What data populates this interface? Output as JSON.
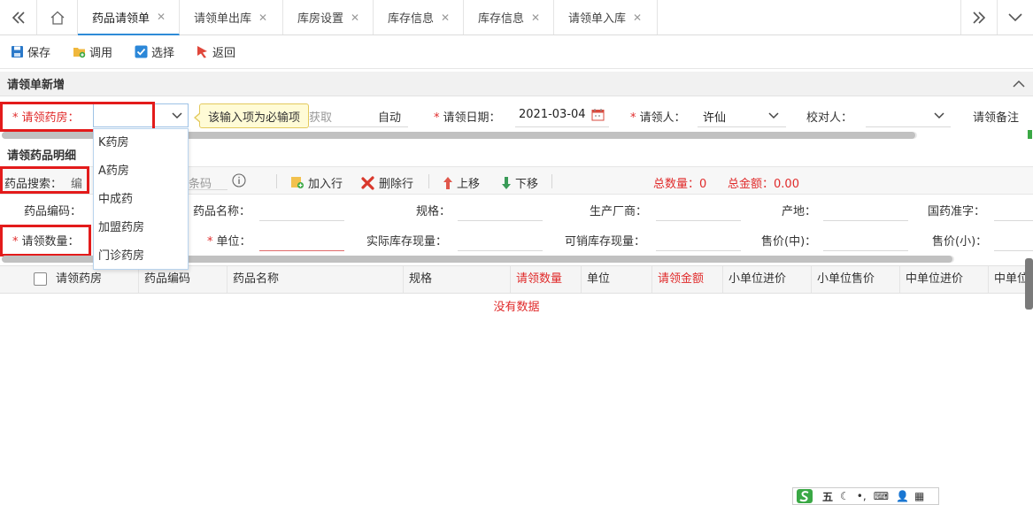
{
  "tabs": {
    "items": [
      {
        "label": "药品请领单"
      },
      {
        "label": "请领单出库"
      },
      {
        "label": "库房设置"
      },
      {
        "label": "库存信息"
      },
      {
        "label": "库存信息"
      },
      {
        "label": "请领单入库"
      }
    ],
    "close_glyph": "✕",
    "active_index": 0
  },
  "toolbar": {
    "save": "保存",
    "invoke": "调用",
    "select": "选择",
    "back": "返回"
  },
  "form_section": {
    "title": "请领单新增",
    "pharmacy_label": "请领药房：",
    "pharmacy_value": "",
    "acquire_partial": "获取",
    "auto_text": "自动",
    "date_label": "请领日期：",
    "date_value": "2021-03-04",
    "requester_label": "请领人：",
    "requester_value": "许仙",
    "checker_label": "校对人：",
    "checker_value": "",
    "remark_label": "请领备注",
    "required_mark": "*"
  },
  "tooltip": {
    "text": "该输入项为必输项"
  },
  "dropdown": {
    "options": [
      "K药房",
      "A药房",
      "中成药",
      "加盟药房",
      "门诊药房"
    ]
  },
  "detail_section": {
    "title": "请领药品明细",
    "search_label": "药品搜索：",
    "search_placeholder_a": "编",
    "search_placeholder_b": "条码",
    "add_row": "加入行",
    "delete_row": "删除行",
    "move_up": "上移",
    "move_down": "下移",
    "total_qty_label": "总数量：",
    "total_qty_value": "0",
    "total_amount_label": "总金额：",
    "total_amount_value": "0.00",
    "fields": {
      "drug_code": "药品编码：",
      "drug_name": "药品名称：",
      "spec": "规格：",
      "manufacturer": "生产厂商：",
      "origin": "产地：",
      "approval_no": "国药准字：",
      "qty": "请领数量：",
      "unit": "单位：",
      "actual_stock": "实际库存现量：",
      "sellable_stock": "可销库存现量：",
      "price_mid": "售价(中)：",
      "price_small": "售价(小)："
    }
  },
  "table": {
    "columns": [
      {
        "label": "请领药房",
        "red": false
      },
      {
        "label": "药品编码",
        "red": false
      },
      {
        "label": "药品名称",
        "red": false
      },
      {
        "label": "规格",
        "red": false
      },
      {
        "label": "请领数量",
        "red": true
      },
      {
        "label": "单位",
        "red": false
      },
      {
        "label": "请领金额",
        "red": true
      },
      {
        "label": "小单位进价",
        "red": false
      },
      {
        "label": "小单位售价",
        "red": false
      },
      {
        "label": "中单位进价",
        "red": false
      },
      {
        "label": "中单位",
        "red": false
      }
    ],
    "empty_text": "没有数据"
  },
  "ime_bar": {
    "text": "五"
  },
  "colors": {
    "accent": "#2e8bd7",
    "required": "#e02b2b",
    "highlight_box": "#e31b1b"
  }
}
